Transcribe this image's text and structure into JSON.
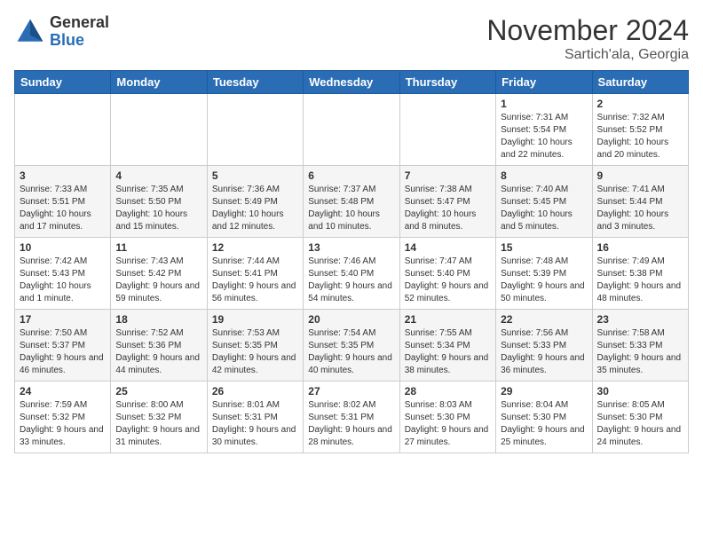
{
  "header": {
    "logo": {
      "line1": "General",
      "line2": "Blue"
    },
    "title": "November 2024",
    "subtitle": "Sartich'ala, Georgia"
  },
  "days_of_week": [
    "Sunday",
    "Monday",
    "Tuesday",
    "Wednesday",
    "Thursday",
    "Friday",
    "Saturday"
  ],
  "weeks": [
    [
      {
        "day": "",
        "info": ""
      },
      {
        "day": "",
        "info": ""
      },
      {
        "day": "",
        "info": ""
      },
      {
        "day": "",
        "info": ""
      },
      {
        "day": "",
        "info": ""
      },
      {
        "day": "1",
        "info": "Sunrise: 7:31 AM\nSunset: 5:54 PM\nDaylight: 10 hours and 22 minutes."
      },
      {
        "day": "2",
        "info": "Sunrise: 7:32 AM\nSunset: 5:52 PM\nDaylight: 10 hours and 20 minutes."
      }
    ],
    [
      {
        "day": "3",
        "info": "Sunrise: 7:33 AM\nSunset: 5:51 PM\nDaylight: 10 hours and 17 minutes."
      },
      {
        "day": "4",
        "info": "Sunrise: 7:35 AM\nSunset: 5:50 PM\nDaylight: 10 hours and 15 minutes."
      },
      {
        "day": "5",
        "info": "Sunrise: 7:36 AM\nSunset: 5:49 PM\nDaylight: 10 hours and 12 minutes."
      },
      {
        "day": "6",
        "info": "Sunrise: 7:37 AM\nSunset: 5:48 PM\nDaylight: 10 hours and 10 minutes."
      },
      {
        "day": "7",
        "info": "Sunrise: 7:38 AM\nSunset: 5:47 PM\nDaylight: 10 hours and 8 minutes."
      },
      {
        "day": "8",
        "info": "Sunrise: 7:40 AM\nSunset: 5:45 PM\nDaylight: 10 hours and 5 minutes."
      },
      {
        "day": "9",
        "info": "Sunrise: 7:41 AM\nSunset: 5:44 PM\nDaylight: 10 hours and 3 minutes."
      }
    ],
    [
      {
        "day": "10",
        "info": "Sunrise: 7:42 AM\nSunset: 5:43 PM\nDaylight: 10 hours and 1 minute."
      },
      {
        "day": "11",
        "info": "Sunrise: 7:43 AM\nSunset: 5:42 PM\nDaylight: 9 hours and 59 minutes."
      },
      {
        "day": "12",
        "info": "Sunrise: 7:44 AM\nSunset: 5:41 PM\nDaylight: 9 hours and 56 minutes."
      },
      {
        "day": "13",
        "info": "Sunrise: 7:46 AM\nSunset: 5:40 PM\nDaylight: 9 hours and 54 minutes."
      },
      {
        "day": "14",
        "info": "Sunrise: 7:47 AM\nSunset: 5:40 PM\nDaylight: 9 hours and 52 minutes."
      },
      {
        "day": "15",
        "info": "Sunrise: 7:48 AM\nSunset: 5:39 PM\nDaylight: 9 hours and 50 minutes."
      },
      {
        "day": "16",
        "info": "Sunrise: 7:49 AM\nSunset: 5:38 PM\nDaylight: 9 hours and 48 minutes."
      }
    ],
    [
      {
        "day": "17",
        "info": "Sunrise: 7:50 AM\nSunset: 5:37 PM\nDaylight: 9 hours and 46 minutes."
      },
      {
        "day": "18",
        "info": "Sunrise: 7:52 AM\nSunset: 5:36 PM\nDaylight: 9 hours and 44 minutes."
      },
      {
        "day": "19",
        "info": "Sunrise: 7:53 AM\nSunset: 5:35 PM\nDaylight: 9 hours and 42 minutes."
      },
      {
        "day": "20",
        "info": "Sunrise: 7:54 AM\nSunset: 5:35 PM\nDaylight: 9 hours and 40 minutes."
      },
      {
        "day": "21",
        "info": "Sunrise: 7:55 AM\nSunset: 5:34 PM\nDaylight: 9 hours and 38 minutes."
      },
      {
        "day": "22",
        "info": "Sunrise: 7:56 AM\nSunset: 5:33 PM\nDaylight: 9 hours and 36 minutes."
      },
      {
        "day": "23",
        "info": "Sunrise: 7:58 AM\nSunset: 5:33 PM\nDaylight: 9 hours and 35 minutes."
      }
    ],
    [
      {
        "day": "24",
        "info": "Sunrise: 7:59 AM\nSunset: 5:32 PM\nDaylight: 9 hours and 33 minutes."
      },
      {
        "day": "25",
        "info": "Sunrise: 8:00 AM\nSunset: 5:32 PM\nDaylight: 9 hours and 31 minutes."
      },
      {
        "day": "26",
        "info": "Sunrise: 8:01 AM\nSunset: 5:31 PM\nDaylight: 9 hours and 30 minutes."
      },
      {
        "day": "27",
        "info": "Sunrise: 8:02 AM\nSunset: 5:31 PM\nDaylight: 9 hours and 28 minutes."
      },
      {
        "day": "28",
        "info": "Sunrise: 8:03 AM\nSunset: 5:30 PM\nDaylight: 9 hours and 27 minutes."
      },
      {
        "day": "29",
        "info": "Sunrise: 8:04 AM\nSunset: 5:30 PM\nDaylight: 9 hours and 25 minutes."
      },
      {
        "day": "30",
        "info": "Sunrise: 8:05 AM\nSunset: 5:30 PM\nDaylight: 9 hours and 24 minutes."
      }
    ]
  ]
}
